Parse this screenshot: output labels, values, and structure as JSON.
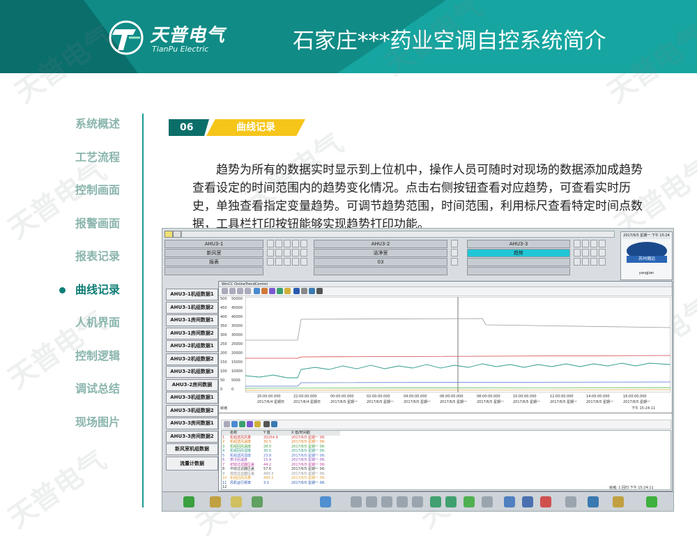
{
  "header": {
    "title": "石家庄***药业空调自控系统简介",
    "logo_cn": "天普电气",
    "logo_en": "TianPu Electric",
    "watermark": "天普电气"
  },
  "nav": {
    "items": [
      "系统概述",
      "工艺流程",
      "控制画面",
      "报警画面",
      "报表记录",
      "曲线记录",
      "人机界面",
      "控制逻辑",
      "调试总结",
      "现场图片"
    ],
    "active_index": 5
  },
  "section": {
    "number": "06",
    "label": "曲线记录"
  },
  "paragraph": "趋势为所有的数据实时显示到上位机中，操作人员可随时对现场的数据添加成趋势查看设定的时间范围内的趋势变化情况。点击右侧按钮查看对应趋势，可查看实时历史，单独查看指定变量趋势。可调节趋势范围，时间范围，利用标尺查看特定时间点数据，工具栏打印按钮能够实现趋势打印功能。",
  "screenshot": {
    "top_rows": {
      "row1": [
        "AHU3-1",
        "AHU3-2",
        "AHU3-3"
      ],
      "row2": [
        "新风室",
        "洁净室",
        "趋势"
      ],
      "row3": [
        "报表",
        "03",
        ""
      ]
    },
    "clock": "2017/6/5 星期一 下午 15:24",
    "badge": "苏州瀚远",
    "user": "yangjian",
    "left_buttons": [
      "AHU3-1机组数据1",
      "AHU3-1机组数据2",
      "AHU3-1房间数据1",
      "AHU3-1房间数据2",
      "AHU3-2机组数据1",
      "AHU3-2机组数据2",
      "AHU3-2机组数据3",
      "AHU3-2房间数据",
      "AHU3-3机组数据1",
      "AHU3-3机组数据2",
      "AHU3-3房间数据1",
      "AHU3-3房间数据2",
      "新风室机组数据",
      "流量计数据"
    ],
    "trend": {
      "title": "WinCC OnlineTrendControl",
      "y_left": [
        "500",
        "450",
        "400",
        "350",
        "300",
        "250",
        "200",
        "150",
        "100",
        "50",
        "0"
      ],
      "y_right": [
        "50000",
        "45000",
        "40000",
        "35000",
        "30000",
        "25000",
        "20000",
        "15000",
        "10000",
        "5000",
        "0"
      ],
      "x_times": [
        "20:00:00.000",
        "22:00:00.000",
        "00:00:00.000",
        "02:00:00.000",
        "04:00:00.000",
        "06:00:00.000",
        "08:00:00.000",
        "10:00:00.000",
        "12:00:00.000",
        "14:00:00.000",
        "16:00:00.000"
      ],
      "x_dates": [
        "2017/6/4 星期日",
        "2017/6/4 星期日",
        "2017/6/5 星期一",
        "2017/6/5 星期一",
        "2017/6/5 星期一",
        "2017/6/5 星期一",
        "2017/6/5 星期一",
        "2017/6/5 星期一",
        "2017/6/5 星期一",
        "2017/6/5 星期一",
        "2017/6/5 星期一"
      ],
      "status_left": "就绪",
      "status_right": "下午 15:24:11",
      "table_headers": [
        "名称",
        "Y 值",
        "X 值/时间戳"
      ],
      "table_rows": [
        [
          "1",
          "机组送风风量",
          "20254.9",
          "2017/6/5 星期一 06:"
        ],
        [
          "2",
          "机组送风温度",
          "30.5",
          "2017/6/5 星期一 06:"
        ],
        [
          "3",
          "机组回风温度",
          "28.0",
          "2017/6/5 星期一 06:"
        ],
        [
          "4",
          "机组回风湿度",
          "30.5",
          "2017/6/5 星期一 06:"
        ],
        [
          "5",
          "机组送风湿度",
          "23.8",
          "2017/6/5 星期一 06:"
        ],
        [
          "6",
          "表冷后温度",
          "15.9",
          "2017/6/5 星期一 06:"
        ],
        [
          "7",
          "初效过滤器压差",
          "44.2",
          "2017/6/5 星期一 06:"
        ],
        [
          "8",
          "中效过滤器压差",
          "57.6",
          "2017/6/5 星期一 06:"
        ],
        [
          "9",
          "高效过滤器压差",
          "490.3",
          "2017/6/5 星期一 06:"
        ],
        [
          "10",
          "机组回风风量",
          "490.3",
          "2017/6/5 星期一 06:"
        ],
        [
          "11",
          "风机运行频率",
          "3.1",
          "2017/6/5 星期一 06:"
        ],
        [
          "12",
          "",
          "",
          ""
        ]
      ],
      "table_status": "就绪: 1 回归 下午 15:24:11"
    }
  },
  "colors": {
    "teal": "#16a5a0",
    "dark_teal": "#0a6e6a",
    "yellow": "#f6c51a",
    "nav_inactive": "#8ab5ad"
  }
}
